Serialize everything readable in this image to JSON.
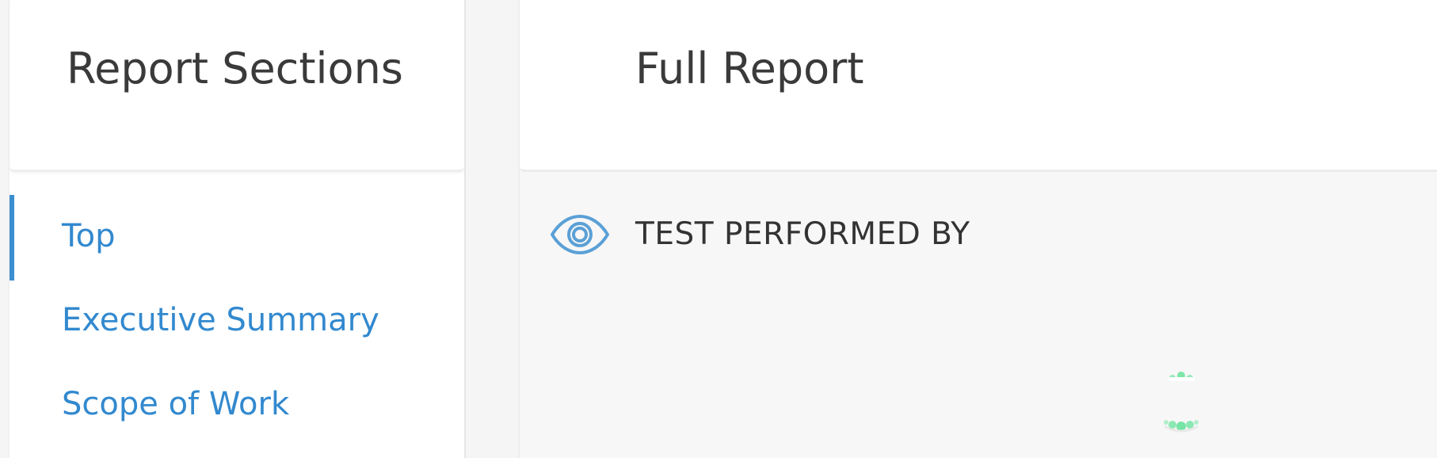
{
  "sidebar": {
    "title": "Report Sections",
    "items": [
      {
        "label": "Top",
        "active": true
      },
      {
        "label": "Executive Summary",
        "active": false
      },
      {
        "label": "Scope of Work",
        "active": false
      }
    ]
  },
  "main": {
    "title": "Full Report",
    "section": {
      "icon": "eye-icon",
      "label": "TEST PERFORMED BY"
    },
    "loading_indicator": "spinner-icon"
  },
  "colors": {
    "accent": "#3289cf",
    "spinner": "#6fe3a0",
    "text": "#3a3a3a"
  }
}
